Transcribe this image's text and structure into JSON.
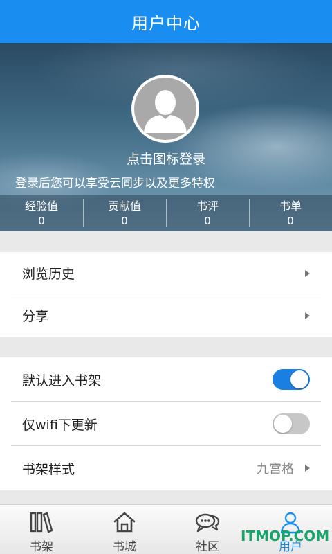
{
  "header": {
    "title": "用户中心"
  },
  "profile": {
    "login_hint": "点击图标登录",
    "login_sub": "登录后您可以享受云同步以及更多特权"
  },
  "stats": [
    {
      "label": "经验值",
      "value": "0"
    },
    {
      "label": "贡献值",
      "value": "0"
    },
    {
      "label": "书评",
      "value": "0"
    },
    {
      "label": "书单",
      "value": "0"
    }
  ],
  "menu": {
    "history": "浏览历史",
    "share": "分享"
  },
  "settings": {
    "default_shelf": {
      "label": "默认进入书架",
      "enabled": true
    },
    "wifi_only": {
      "label": "仅wifi下更新",
      "enabled": false
    },
    "shelf_style": {
      "label": "书架样式",
      "value": "九宫格"
    }
  },
  "tabs": [
    {
      "label": "书架",
      "icon": "bookshelf-icon"
    },
    {
      "label": "书城",
      "icon": "home-icon"
    },
    {
      "label": "社区",
      "icon": "chat-icon"
    },
    {
      "label": "用户",
      "icon": "user-icon",
      "active": true
    }
  ],
  "watermark": "ITMOP.COM",
  "colors": {
    "accent": "#1a8ef0",
    "toggle_on": "#1a7fe0",
    "watermark": "#1aa36a"
  }
}
